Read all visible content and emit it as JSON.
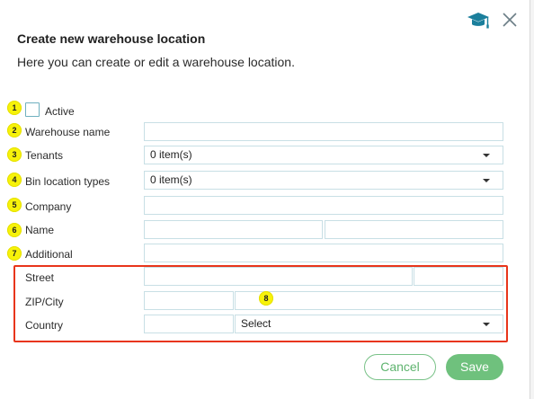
{
  "dialog": {
    "title": "Create new warehouse location",
    "subtitle": "Here you can create or edit a warehouse location."
  },
  "header_icons": {
    "help": "graduation-cap-icon",
    "close": "close-icon"
  },
  "badges": [
    "1",
    "2",
    "3",
    "4",
    "5",
    "6",
    "7",
    "8"
  ],
  "form": {
    "active_label": "Active",
    "active_checked": false,
    "warehouse_name_label": "Warehouse name",
    "warehouse_name_value": "",
    "tenants_label": "Tenants",
    "tenants_value": "0 item(s)",
    "bin_location_types_label": "Bin location types",
    "bin_location_types_value": "0 item(s)",
    "company_label": "Company",
    "company_value": "",
    "name_label": "Name",
    "name_first_value": "",
    "name_last_value": "",
    "additional_label": "Additional",
    "additional_value": "",
    "street_label": "Street",
    "street_value": "",
    "street_number_value": "",
    "zip_city_label": "ZIP/City",
    "zip_value": "",
    "city_value": "",
    "country_label": "Country",
    "country_code_value": "",
    "country_select_value": "Select"
  },
  "buttons": {
    "cancel": "Cancel",
    "save": "Save"
  },
  "colors": {
    "badge": "#f7f20a",
    "highlight_border": "#e8351b",
    "accent_green": "#6fc17d",
    "input_border": "#c8dfe5",
    "help_icon": "#1b7f9c"
  }
}
